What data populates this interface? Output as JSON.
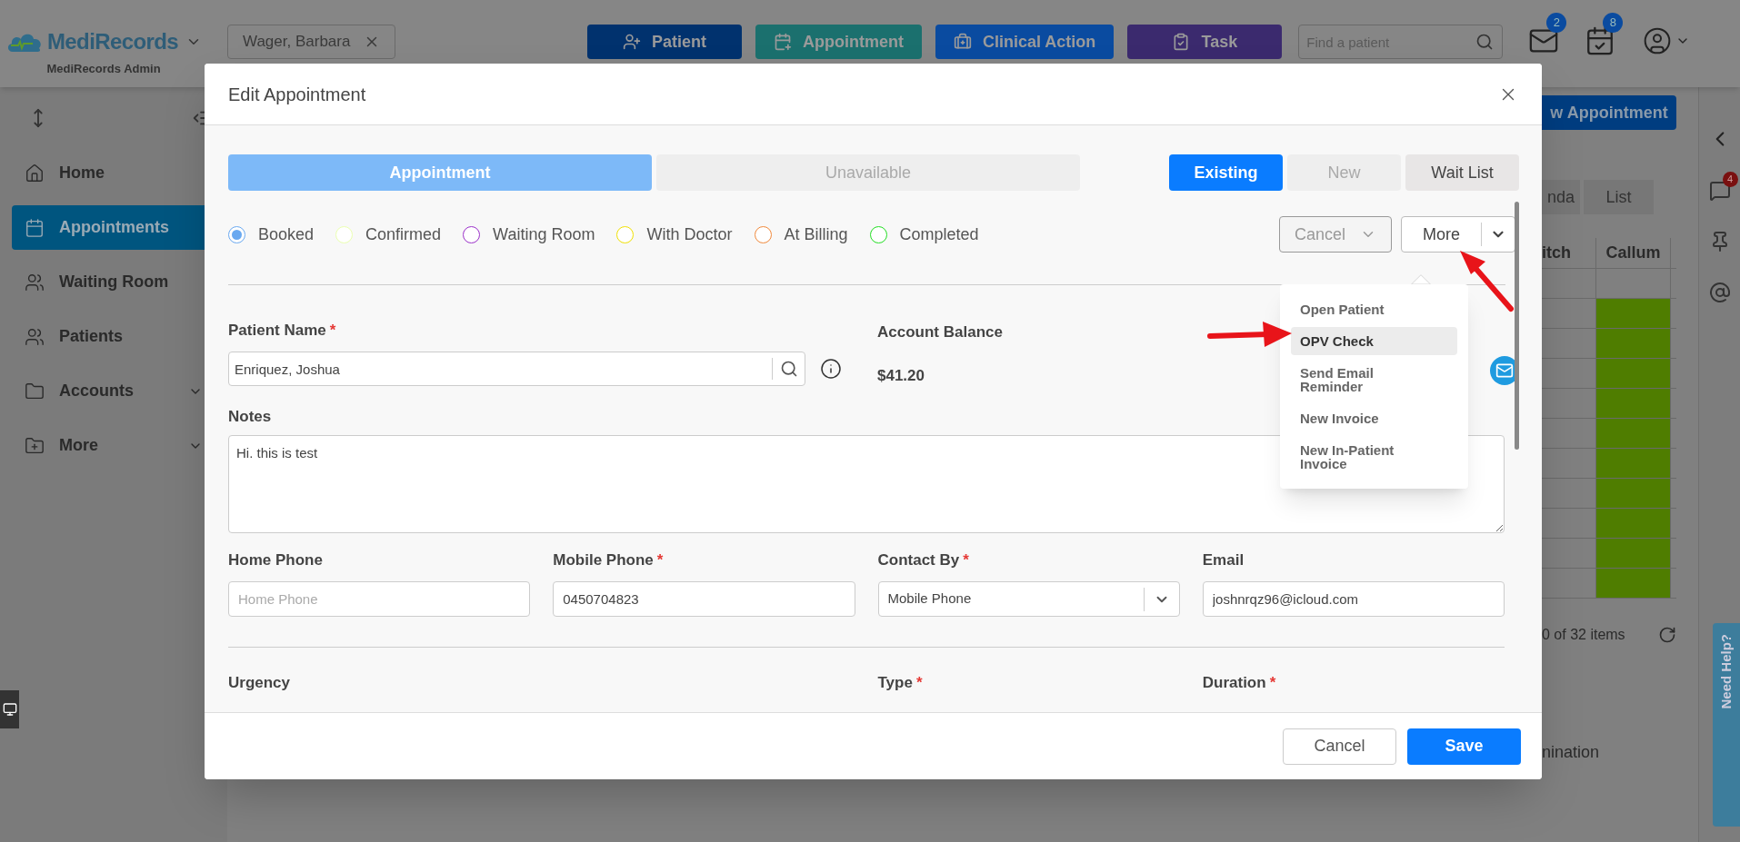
{
  "header": {
    "logo": "MediRecords",
    "account": "MediRecords Admin",
    "patient_chip": "Wager, Barbara",
    "actions": [
      {
        "label": "Patient",
        "kind": "patient",
        "color": "#01326e"
      },
      {
        "label": "Appointment",
        "kind": "appointment",
        "color": "#1b706e"
      },
      {
        "label": "Clinical Action",
        "kind": "clinical",
        "color": "#0a4ba0"
      },
      {
        "label": "Task",
        "kind": "task",
        "color": "#3b2a6e"
      }
    ],
    "search": {
      "placeholder": "Find a patient"
    },
    "notifications": [
      {
        "kind": "mail",
        "count": "2"
      },
      {
        "kind": "calendar",
        "count": "8"
      }
    ]
  },
  "sidebar": {
    "items": [
      {
        "label": "Home",
        "kind": "home",
        "selected": false,
        "expandable": false
      },
      {
        "label": "Appointments",
        "kind": "calendar",
        "selected": true,
        "expandable": false
      },
      {
        "label": "Waiting Room",
        "kind": "waiting",
        "selected": false,
        "expandable": false
      },
      {
        "label": "Patients",
        "kind": "users",
        "selected": false,
        "expandable": false
      },
      {
        "label": "Accounts",
        "kind": "folder",
        "selected": false,
        "expandable": true
      },
      {
        "label": "More",
        "kind": "folder-plus",
        "selected": false,
        "expandable": true
      }
    ]
  },
  "background": {
    "new_button": "w Appointment",
    "view_tabs": [
      {
        "label": "nda",
        "selected": false
      },
      {
        "label": "List",
        "selected": false
      }
    ],
    "columns": [
      "itch",
      "Callum"
    ],
    "callum_slots": [
      {
        "booked": false
      },
      {
        "booked": true
      },
      {
        "booked": true
      },
      {
        "booked": true
      },
      {
        "booked": true
      },
      {
        "booked": true
      },
      {
        "booked": true
      },
      {
        "booked": true
      },
      {
        "booked": true
      },
      {
        "booked": true
      },
      {
        "booked": true
      }
    ],
    "pager": "0 of 32 items",
    "fragment": "nination"
  },
  "right_rail": {
    "chat_badge": "4"
  },
  "help_tab": "Need Help?",
  "modal": {
    "title": "Edit Appointment",
    "mode_tabs": [
      {
        "label": "Appointment",
        "selected": true
      },
      {
        "label": "Unavailable",
        "selected": false
      }
    ],
    "patient_tabs": [
      {
        "label": "Existing",
        "selected": true,
        "disabled": false
      },
      {
        "label": "New",
        "selected": false,
        "disabled": true
      },
      {
        "label": "Wait List",
        "selected": false,
        "disabled": false
      }
    ],
    "statuses": [
      {
        "label": "Booked",
        "color": "#6aa9f0",
        "selected": true
      },
      {
        "label": "Confirmed",
        "color": "#eaffb0",
        "selected": false
      },
      {
        "label": "Waiting Room",
        "color": "#9b30c9",
        "selected": false
      },
      {
        "label": "With Doctor",
        "color": "#f0e000",
        "selected": false
      },
      {
        "label": "At Billing",
        "color": "#f0883a",
        "selected": false
      },
      {
        "label": "Completed",
        "color": "#22dd22",
        "selected": false
      }
    ],
    "status_button": {
      "label": "Cancel",
      "disabled": true
    },
    "more_button": {
      "label": "More",
      "expanded": true
    },
    "more_menu": [
      {
        "label": "Open Patient",
        "selected": false
      },
      {
        "label": "OPV Check",
        "selected": true
      },
      {
        "label": "Send Email Reminder",
        "selected": false
      },
      {
        "label": "New Invoice",
        "selected": false
      },
      {
        "label": "New In-Patient Invoice",
        "selected": false
      }
    ],
    "patient_name": {
      "label": "Patient Name",
      "required_mark": "*",
      "value": "Enriquez, Joshua"
    },
    "account_balance": {
      "label": "Account Balance",
      "value": "$41.20"
    },
    "notes": {
      "label": "Notes",
      "value": "Hi. this is test"
    },
    "contact_fields": [
      {
        "kind": "text",
        "label": "Home Phone",
        "placeholder": "Home Phone"
      },
      {
        "kind": "text",
        "label": "Mobile Phone",
        "required_mark": "*",
        "value": "0450704823"
      },
      {
        "kind": "select",
        "label": "Contact By",
        "required_mark": "*",
        "value": "Mobile Phone"
      },
      {
        "kind": "text",
        "label": "Email",
        "value": "joshnrqz96@icloud.com"
      }
    ],
    "schedule_labels": [
      {
        "label": "Urgency"
      },
      {
        "label": "Type",
        "required_mark": "*"
      },
      {
        "label": "Duration",
        "required_mark": "*"
      }
    ],
    "footer_buttons": [
      {
        "label": "Cancel",
        "kind": "secondary"
      },
      {
        "label": "Save",
        "kind": "primary"
      }
    ]
  }
}
